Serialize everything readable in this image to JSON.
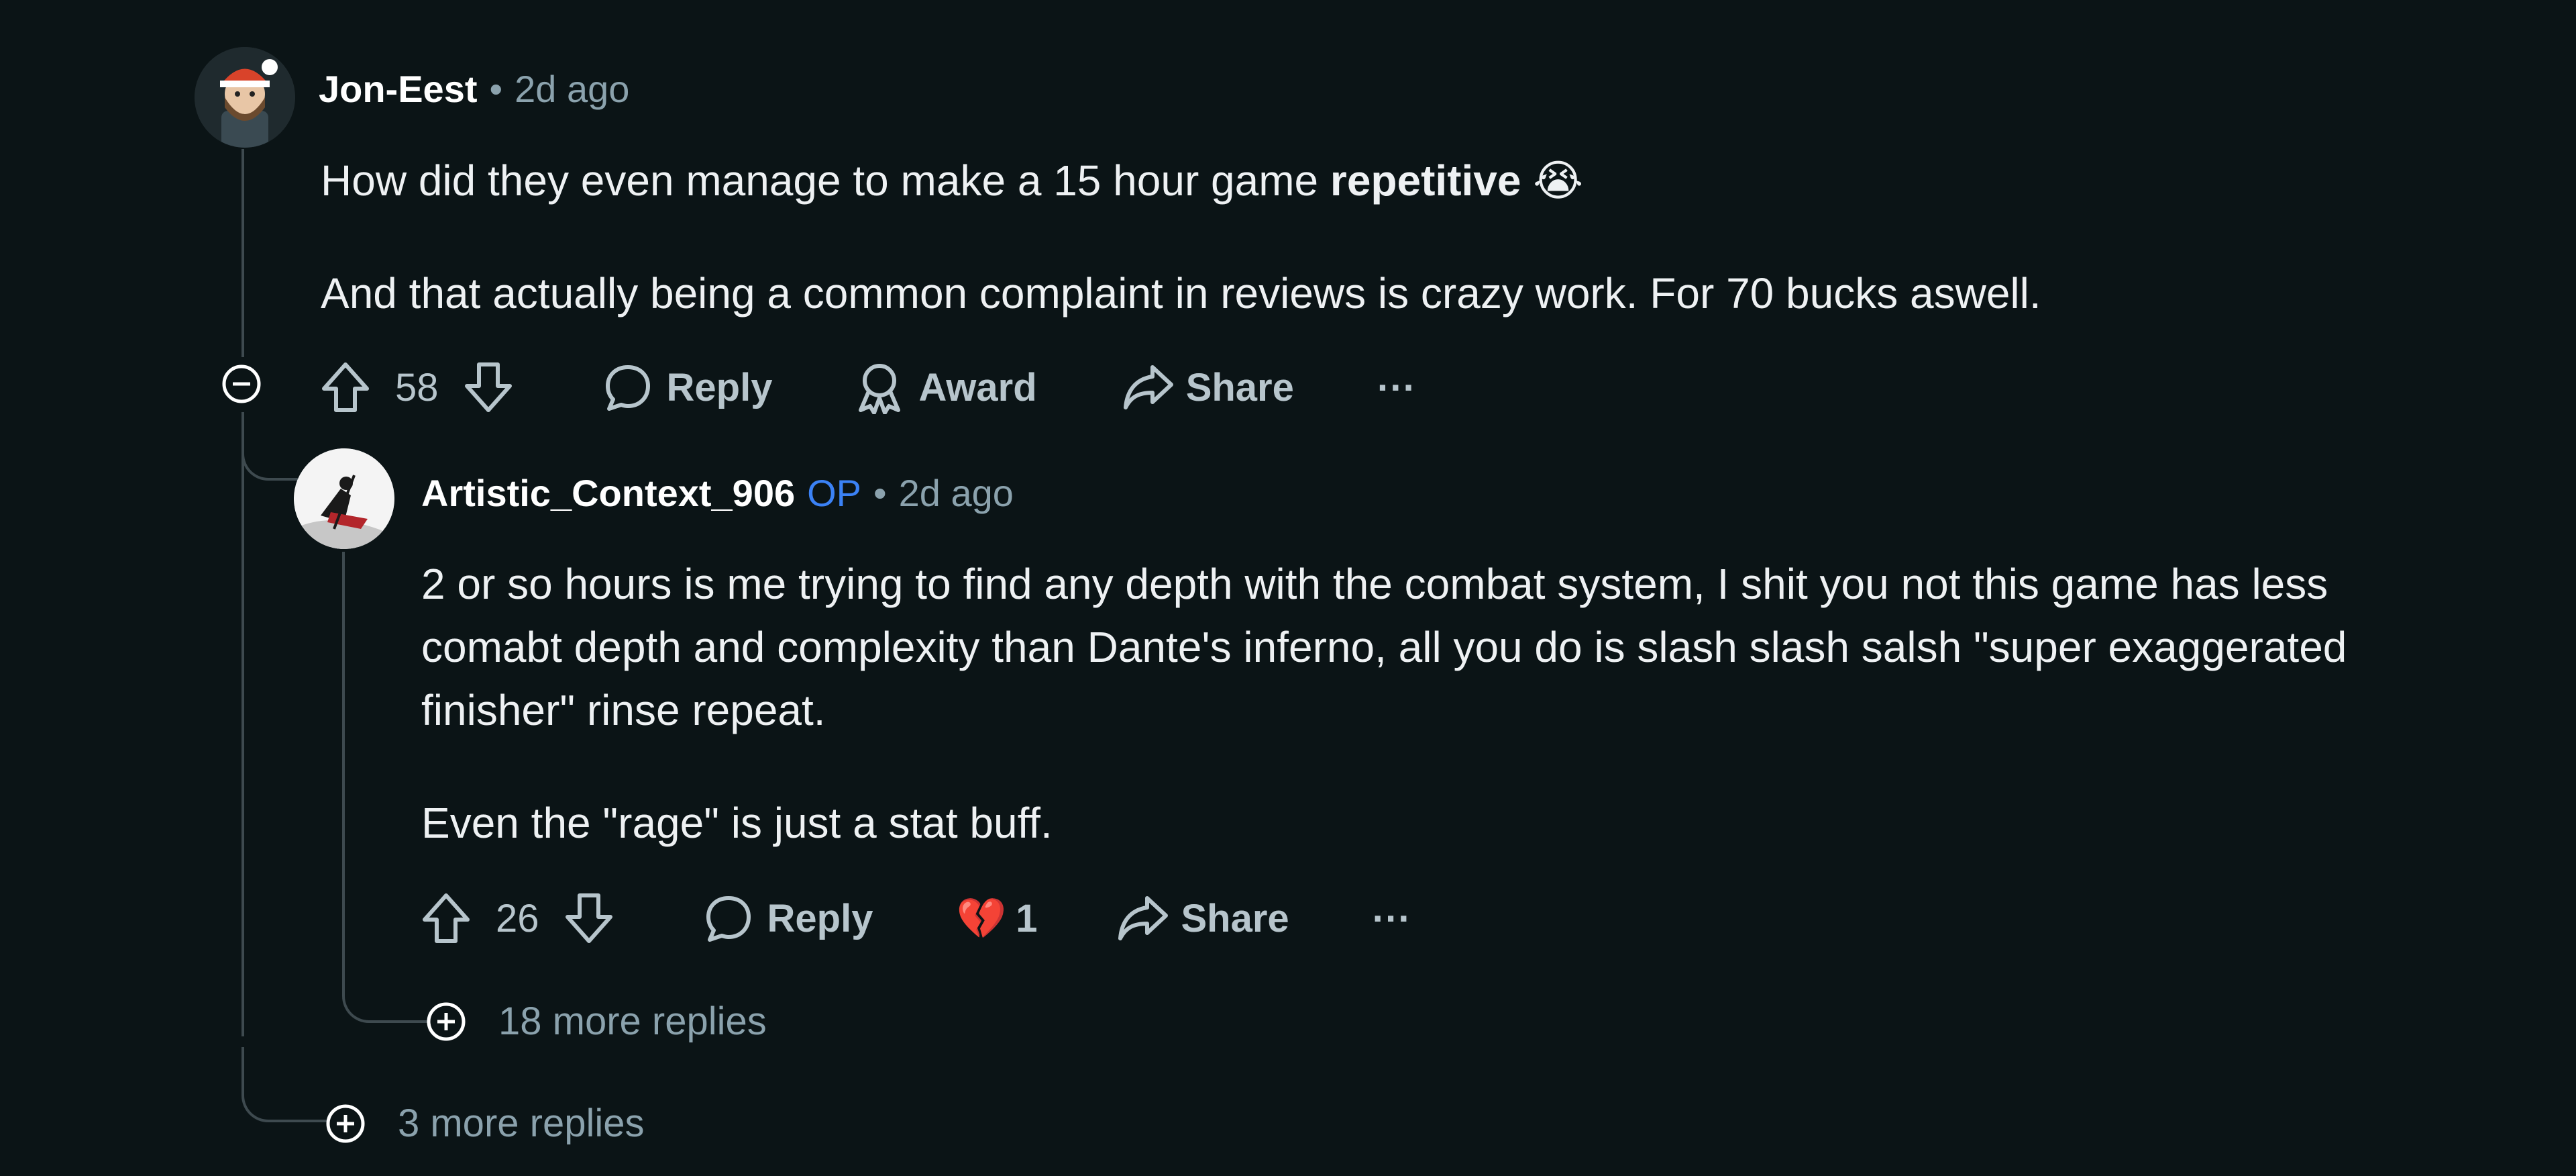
{
  "comment1": {
    "author": "Jon-Eest",
    "dot": "•",
    "time": "2d ago",
    "para1_plain": "How did they even manage to make a 15 hour game ",
    "para1_bold": "repetitive",
    "para1_emoji": "😭",
    "para2": "And that actually being a common complaint in reviews is crazy work. For 70 bucks aswell.",
    "votes": "58",
    "reply_label": "Reply",
    "award_label": "Award",
    "share_label": "Share",
    "more_label": "···"
  },
  "comment2": {
    "author": "Artistic_Context_906",
    "op_badge": "OP",
    "dot": "•",
    "time": "2d ago",
    "para1": "2 or so hours is me trying to find any depth with the combat system, I shit you not this game has less comabt depth and complexity than Dante's inferno, all you do is slash slash salsh \"super exaggerated finisher\" rinse repeat.",
    "para2": "Even the \"rage\" is just a stat buff.",
    "votes": "26",
    "reply_label": "Reply",
    "award_emoji": "💔",
    "award_count": "1",
    "share_label": "Share",
    "more_label": "···",
    "more_replies": "18 more replies"
  },
  "thread": {
    "more_replies": "3 more replies"
  },
  "colors": {
    "background": "#0b1416",
    "op_badge": "#3b82f6",
    "muted": "#8ba2ad",
    "thread_line": "#3e4a4f"
  },
  "icons": [
    "upvote-icon",
    "downvote-icon",
    "comment-icon",
    "award-icon",
    "share-icon",
    "collapse-icon",
    "expand-icon",
    "more-icon"
  ]
}
